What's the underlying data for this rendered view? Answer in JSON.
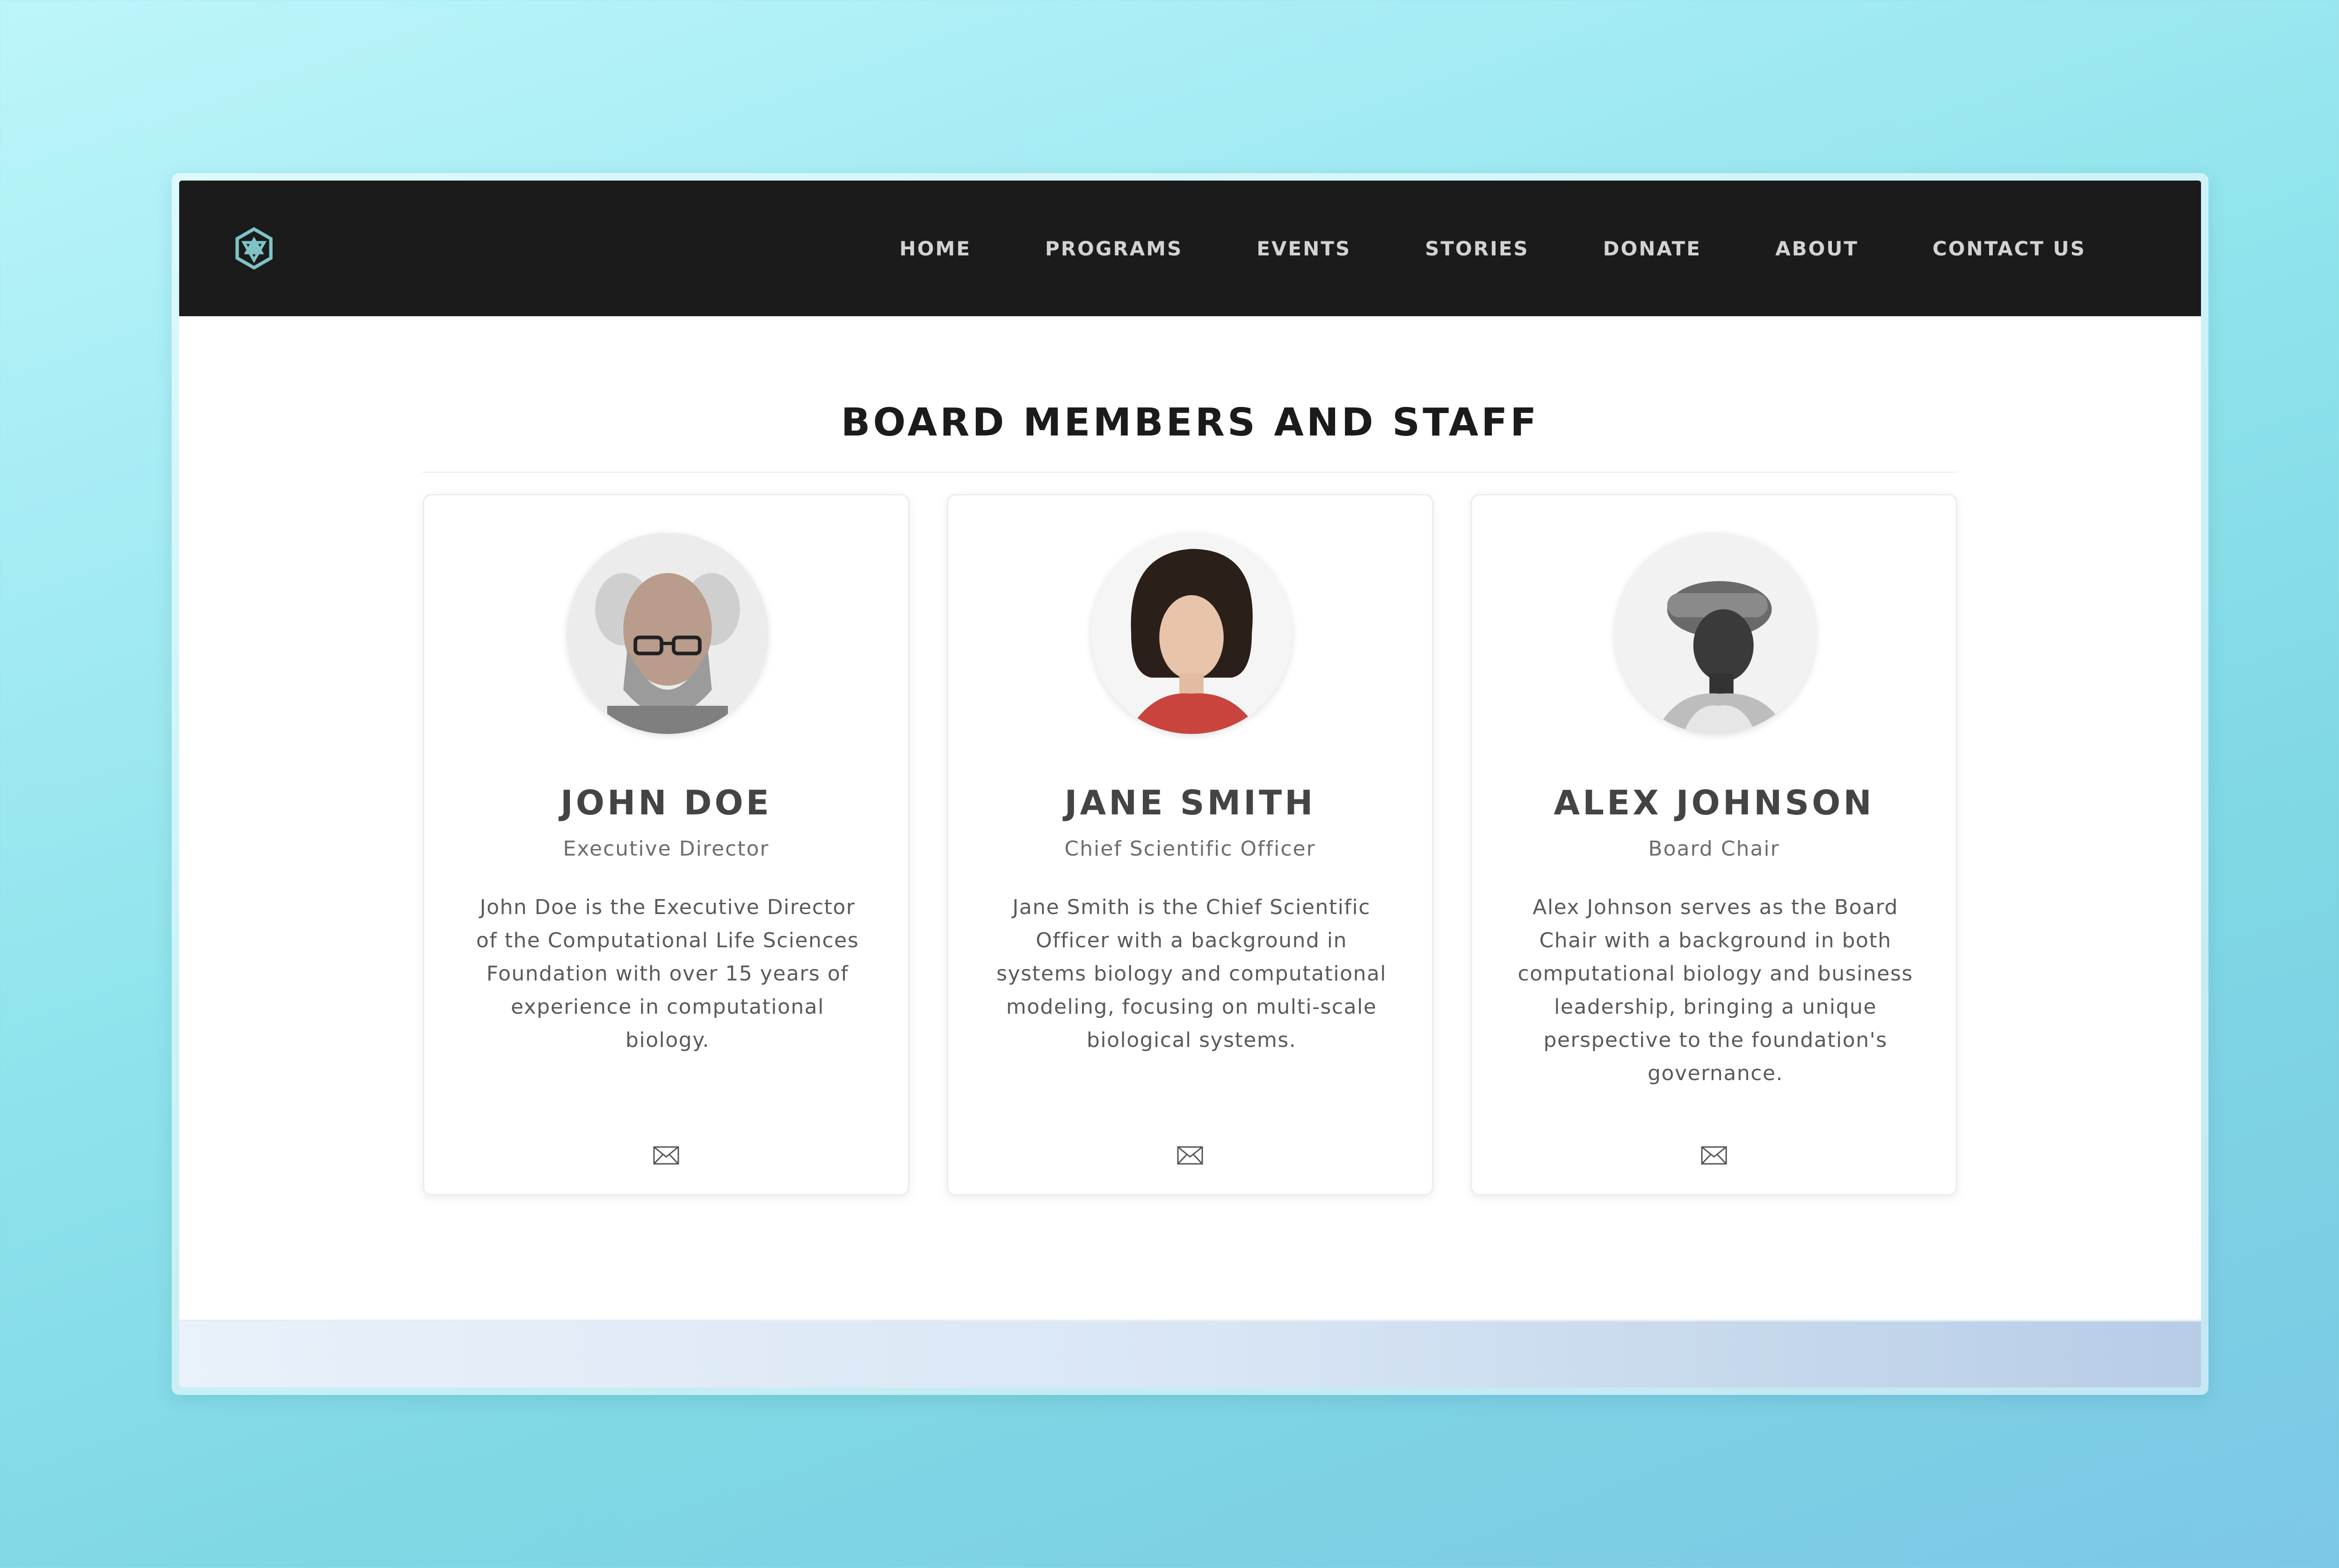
{
  "nav": {
    "logo_icon": "hexagon-knot-logo-icon",
    "logo_color": "#7ec4c7",
    "items": [
      {
        "label": "HOME"
      },
      {
        "label": "PROGRAMS"
      },
      {
        "label": "EVENTS"
      },
      {
        "label": "STORIES"
      },
      {
        "label": "DONATE"
      },
      {
        "label": "ABOUT"
      },
      {
        "label": "CONTACT US"
      }
    ]
  },
  "section": {
    "title": "BOARD MEMBERS AND STAFF"
  },
  "members": [
    {
      "name": "JOHN DOE",
      "role": "Executive Director",
      "bio": "John Doe is the Executive Director of the Computational Life Sciences Foundation with over 15 years of experience in computational biology.",
      "contact_icon": "envelope-icon"
    },
    {
      "name": "JANE SMITH",
      "role": "Chief Scientific Officer",
      "bio": "Jane Smith is the Chief Scientific Officer with a background in systems biology and computational modeling, focusing on multi-scale biological systems.",
      "contact_icon": "envelope-icon"
    },
    {
      "name": "ALEX JOHNSON",
      "role": "Board Chair",
      "bio": "Alex Johnson serves as the Board Chair with a background in both computational biology and business leadership, bringing a unique perspective to the foundation's governance.",
      "contact_icon": "envelope-icon"
    }
  ],
  "colors": {
    "navbar_bg": "#1b1b1b",
    "nav_text": "#d2d2d2",
    "accent": "#7ec4c7"
  }
}
